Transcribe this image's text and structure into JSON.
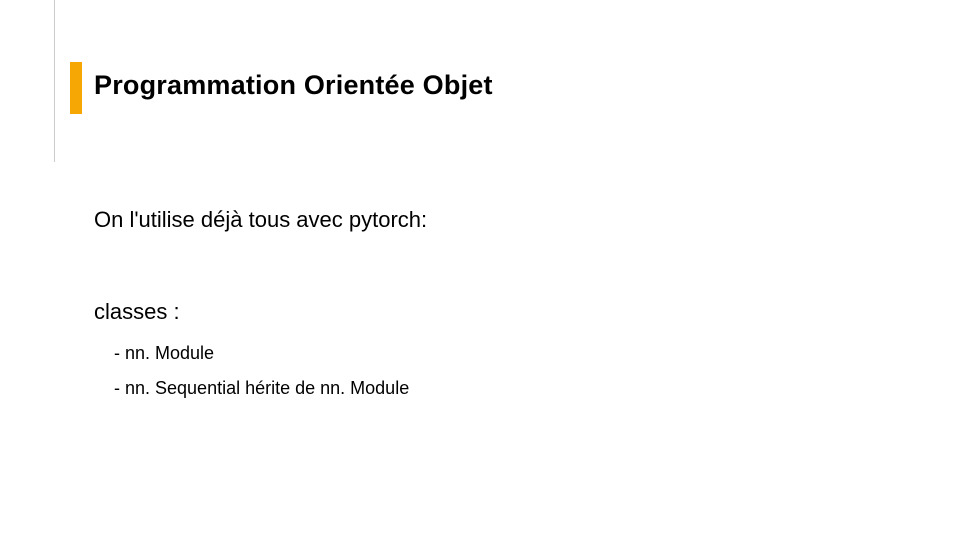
{
  "slide": {
    "title": "Programmation Orientée Objet",
    "line1": "On l'utilise déjà tous  avec pytorch:",
    "line2": "classes :",
    "bullets": [
      "- nn. Module",
      "- nn. Sequential hérite de nn. Module"
    ],
    "accent_color": "#f6a704"
  }
}
